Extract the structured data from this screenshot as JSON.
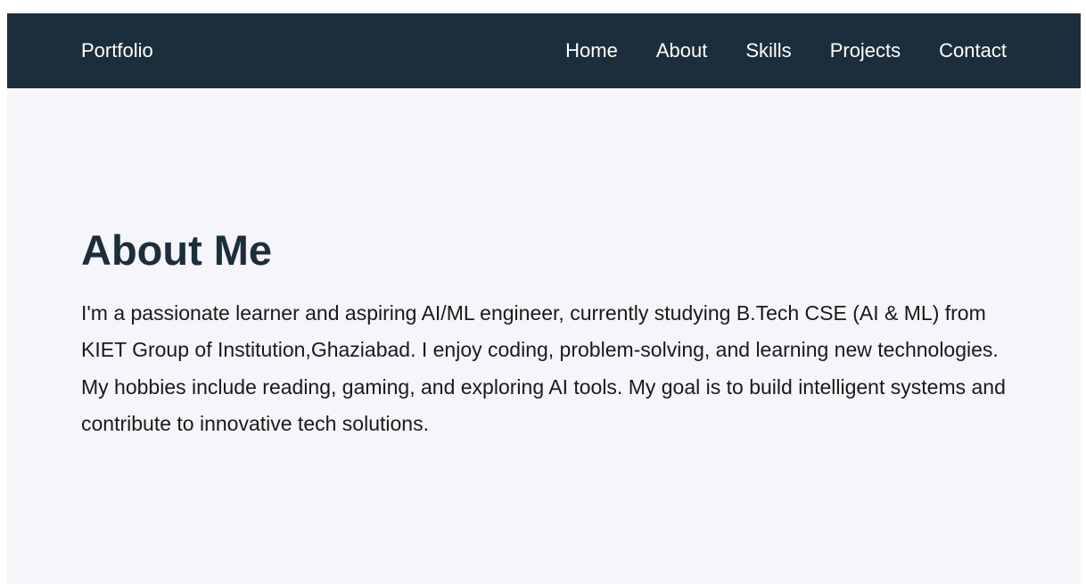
{
  "navbar": {
    "brand": "Portfolio",
    "links": [
      {
        "label": "Home"
      },
      {
        "label": "About"
      },
      {
        "label": "Skills"
      },
      {
        "label": "Projects"
      },
      {
        "label": "Contact"
      }
    ]
  },
  "about": {
    "heading": "About Me",
    "body": "I'm a passionate learner and aspiring AI/ML engineer, currently studying B.Tech CSE (AI & ML) from KIET Group of Institution,Ghaziabad. I enjoy coding, problem-solving, and learning new technologies. My hobbies include reading, gaming, and exploring AI tools. My goal is to build intelligent systems and contribute to innovative tech solutions."
  },
  "colors": {
    "navbar_bg": "#1c2e3b",
    "page_bg": "#f5f5fa",
    "heading": "#1c2e3b",
    "body_text": "#1a1a1a",
    "nav_text": "#ffffff"
  }
}
